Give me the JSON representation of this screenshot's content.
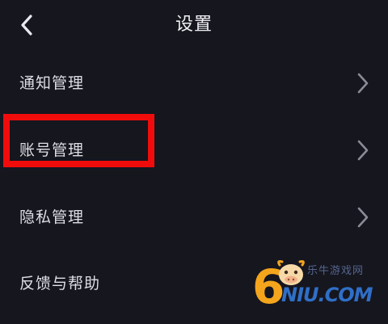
{
  "header": {
    "title": "设置",
    "back_icon": "chevron-left-icon"
  },
  "menu": {
    "items": [
      {
        "label": "通知管理",
        "icon": "chevron-right-icon"
      },
      {
        "label": "账号管理",
        "icon": "chevron-right-icon",
        "highlighted": true
      },
      {
        "label": "隐私管理",
        "icon": "chevron-right-icon"
      },
      {
        "label": "反馈与帮助"
      }
    ]
  },
  "annotation": {
    "highlight_color": "#f10c0c"
  },
  "watermark": {
    "digit": "6",
    "site_name": "乐牛游戏网",
    "domain": "NIU.COM",
    "colors": {
      "digit": "#f4a51c",
      "domain": "#2f6fc7"
    }
  },
  "colors": {
    "background": "#16161f",
    "text": "#dddee6",
    "chevron": "#8a8b96"
  }
}
